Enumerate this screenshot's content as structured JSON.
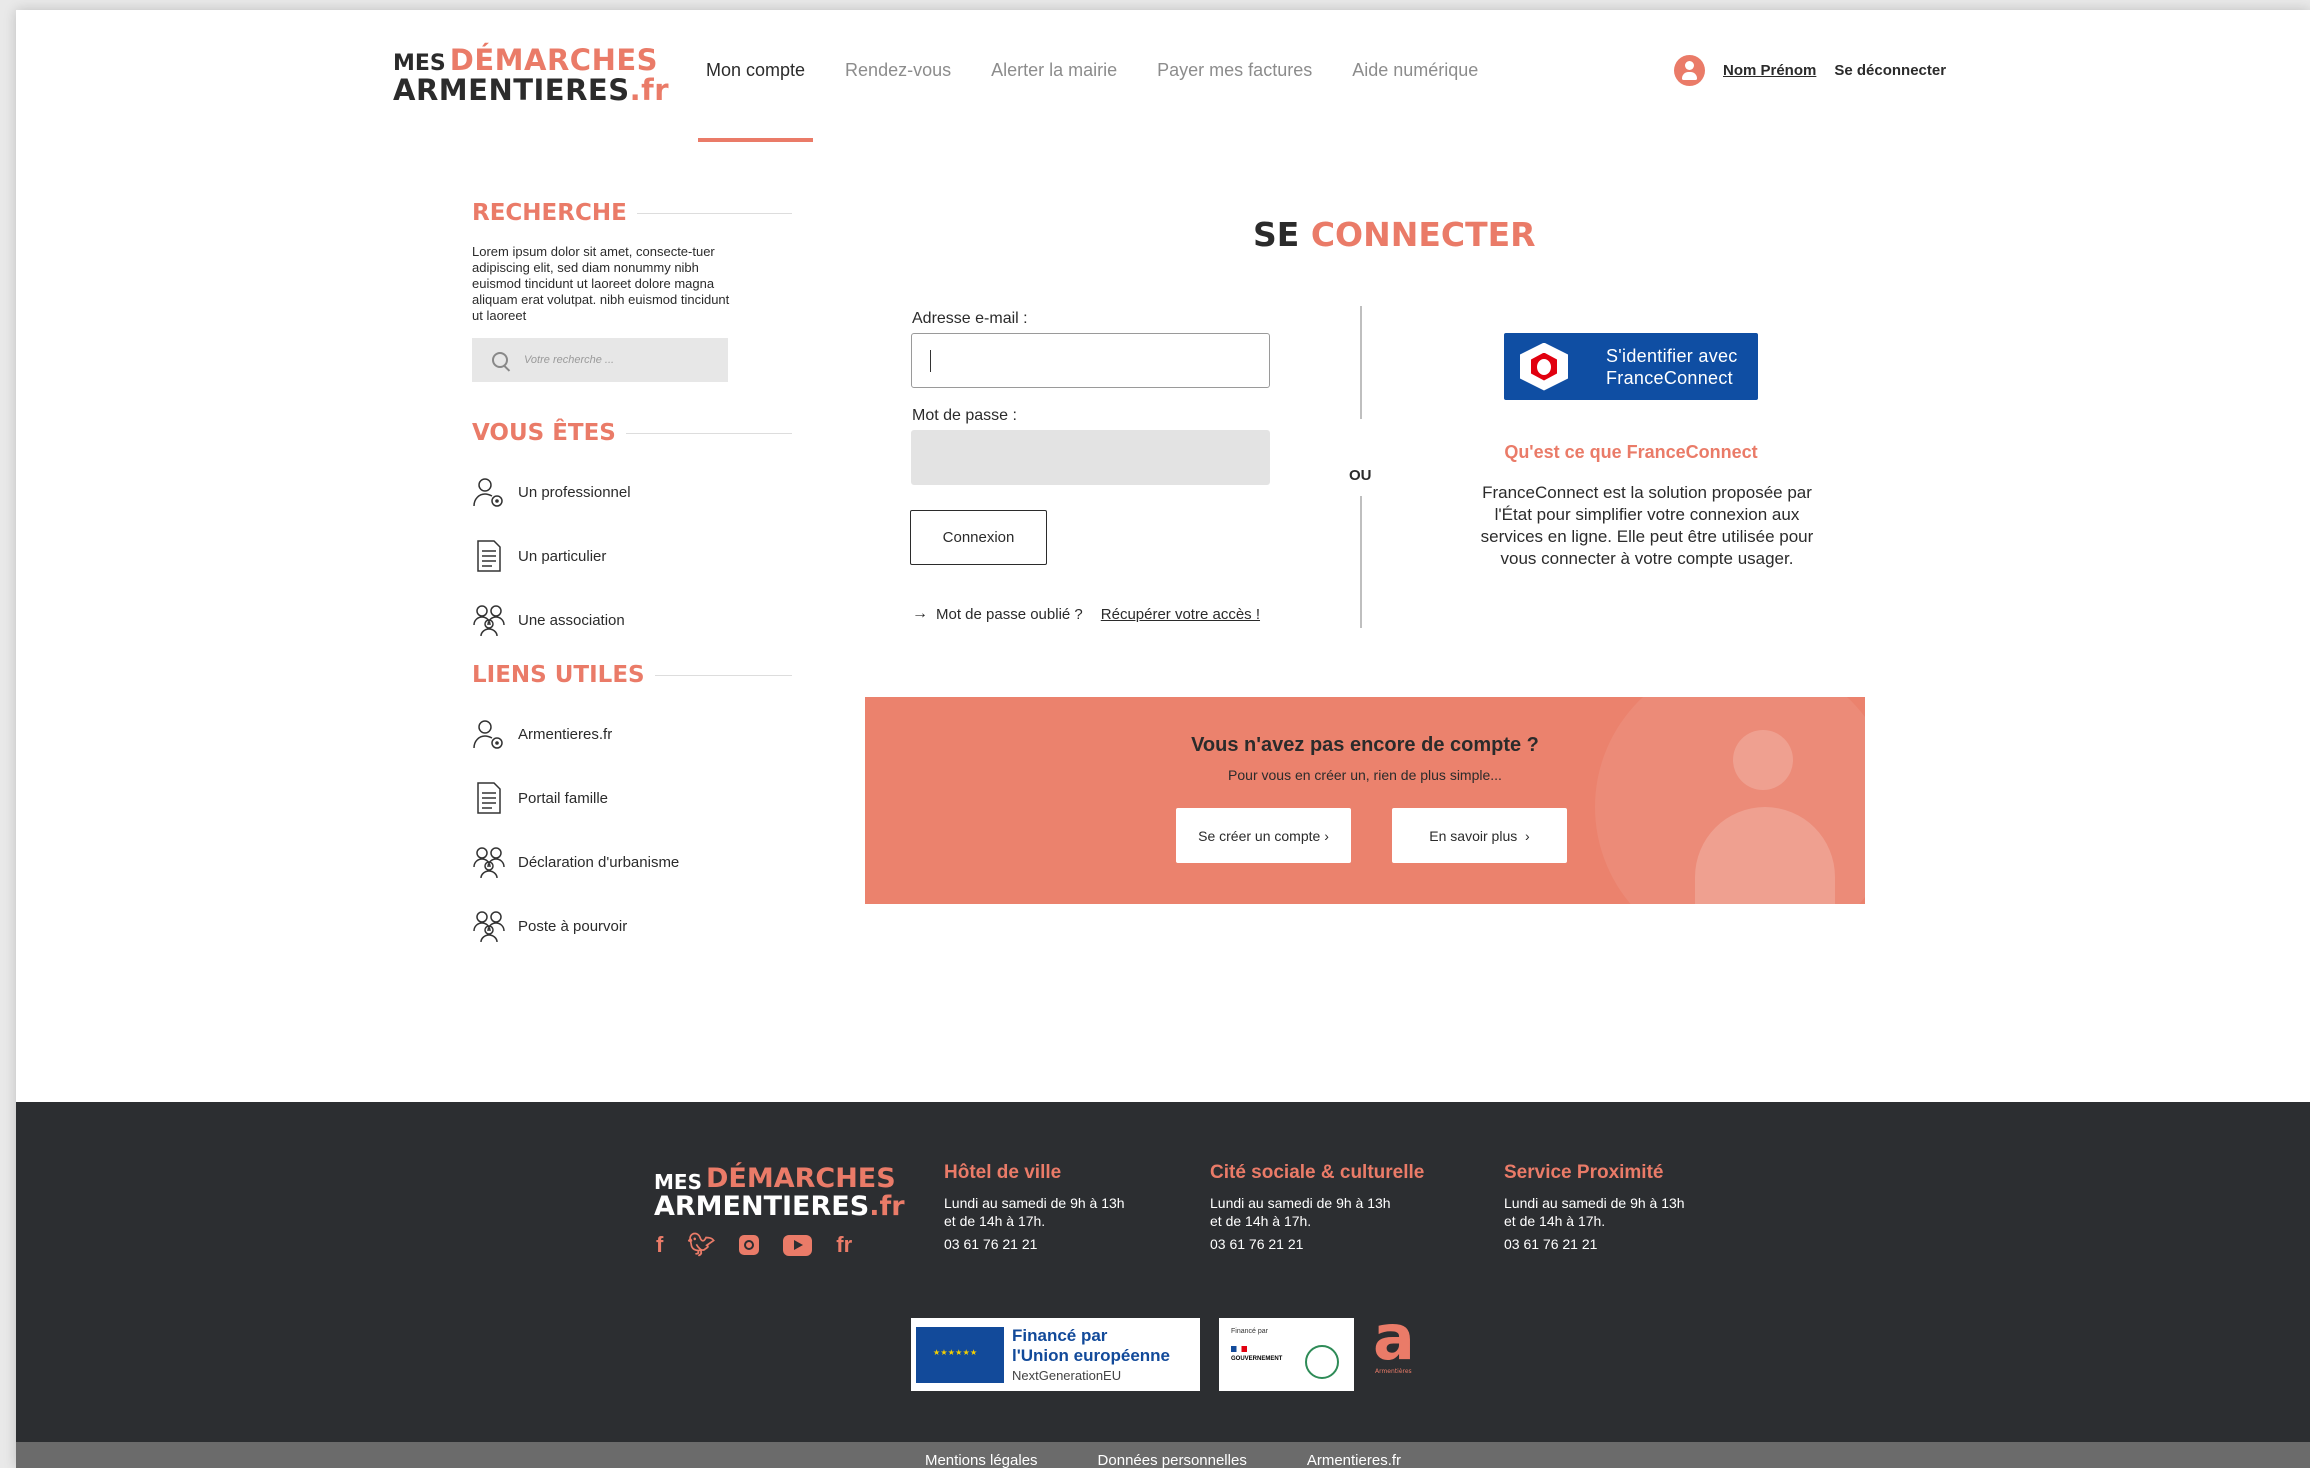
{
  "header": {
    "logo": {
      "line1_small": "MES",
      "line1_big": "DÉMARCHES",
      "line2": "ARMENTIERES",
      "line2_suffix": ".fr"
    },
    "nav": [
      "Mon compte",
      "Rendez-vous",
      "Alerter la mairie",
      "Payer mes factures",
      "Aide numérique"
    ],
    "active_nav": "Mon compte",
    "user_name": "Nom Prénom",
    "logout": "Se déconnecter"
  },
  "sidebar": {
    "search": {
      "title": "RECHERCHE",
      "text": "Lorem ipsum dolor sit amet, consecte-tuer adipiscing elit, sed diam nonummy nibh euismod tincidunt ut laoreet dolore magna aliquam erat volutpat. nibh euismod tincidunt ut laoreet",
      "placeholder": "Votre recherche ..."
    },
    "vous_etes": {
      "title": "VOUS ÊTES",
      "items": [
        {
          "label": "Un professionnel",
          "icon": "person-gear-icon"
        },
        {
          "label": "Un particulier",
          "icon": "document-icon"
        },
        {
          "label": "Une association",
          "icon": "group-icon"
        }
      ]
    },
    "liens_utiles": {
      "title": "LIENS UTILES",
      "items": [
        {
          "label": "Armentieres.fr",
          "icon": "person-gear-icon"
        },
        {
          "label": "Portail famille",
          "icon": "document-icon"
        },
        {
          "label": "Déclaration d'urbanisme",
          "icon": "group-icon"
        },
        {
          "label": "Poste à pourvoir",
          "icon": "group-icon"
        }
      ]
    }
  },
  "login": {
    "title_a": "SE",
    "title_b": "CONNECTER",
    "email_label": "Adresse e-mail :",
    "email_value": "",
    "password_label": "Mot de passe :",
    "submit": "Connexion",
    "forgot_text": "Mot de passe oublié ?",
    "forgot_link": "Récupérer votre accès !",
    "separator": "OU"
  },
  "franceconnect": {
    "button_line1": "S'identifier avec",
    "button_line2": "FranceConnect",
    "question": "Qu'est ce que FranceConnect",
    "description": "FranceConnect est la solution proposée par l'État pour simplifier votre connexion aux services en ligne. Elle peut être utilisée pour vous connecter à votre compte usager."
  },
  "cta": {
    "title": "Vous n'avez pas encore de compte ?",
    "subtitle": "Pour vous en créer un, rien de plus simple...",
    "create_btn": "Se créer un compte",
    "more_btn": "En savoir plus"
  },
  "footer": {
    "social": [
      "facebook-icon",
      "twitter-icon",
      "instagram-icon",
      "youtube-icon",
      "fr-icon"
    ],
    "columns": [
      {
        "title": "Hôtel de ville",
        "line1": "Lundi au samedi de 9h à 13h",
        "line2": "et de 14h à 17h.",
        "phone": "03 61 76 21 21"
      },
      {
        "title": "Cité sociale & culturelle",
        "line1": "Lundi au samedi de 9h à 13h",
        "line2": "et de 14h à 17h.",
        "phone": "03 61 76 21 21"
      },
      {
        "title": "Service Proximité",
        "line1": "Lundi au samedi de 9h à 13h",
        "line2": "et de 14h à 17h.",
        "phone": "03 61 76 21 21"
      }
    ],
    "eu": {
      "line1": "Financé par",
      "line2": "l'Union européenne",
      "line3": "NextGenerationEU"
    },
    "gov": {
      "financed": "Financé par",
      "name": "GOUVERNEMENT"
    },
    "links": [
      "Mentions légales",
      "Données personnelles",
      "Armentieres.fr"
    ]
  },
  "colors": {
    "accent": "#ea7b68",
    "dark": "#2c2e31",
    "fc_blue": "#0f4ea3"
  }
}
